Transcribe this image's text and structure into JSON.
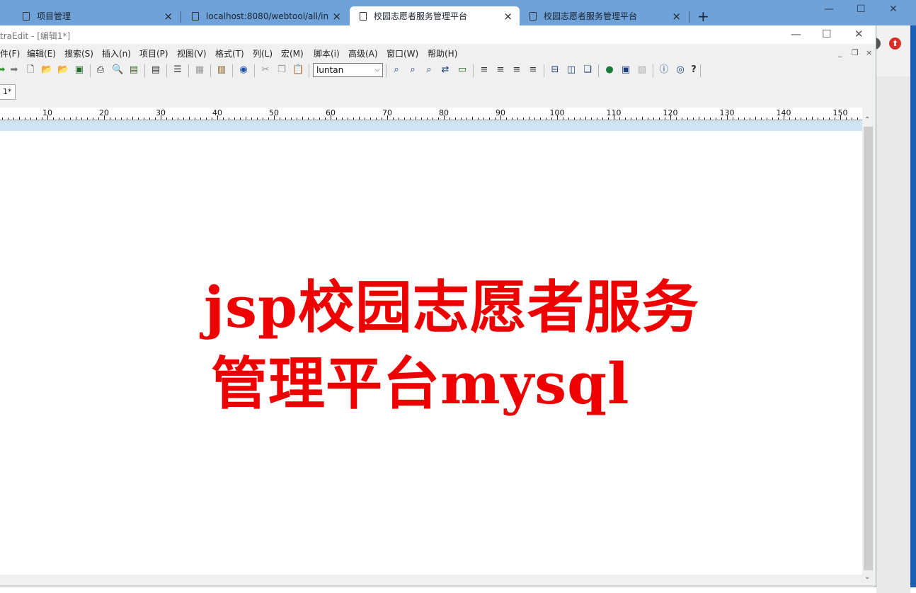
{
  "browser": {
    "tabs": [
      {
        "label": "项目管理",
        "active": false
      },
      {
        "label": "localhost:8080/webtool/all/in",
        "active": false
      },
      {
        "label": "校园志愿者服务管理平台",
        "active": true
      },
      {
        "label": "校园志愿者服务管理平台",
        "active": false
      }
    ],
    "new_tab": "+",
    "controls": {
      "minimize": "—",
      "maximize": "☐",
      "close": "✕"
    }
  },
  "editor": {
    "title": "traEdit - [编辑1*]",
    "controls": {
      "minimize": "—",
      "maximize": "☐",
      "close": "✕"
    },
    "menu": [
      "件(F)",
      "编辑(E)",
      "搜索(S)",
      "插入(n)",
      "项目(P)",
      "视图(V)",
      "格式(T)",
      "列(L)",
      "宏(M)",
      "脚本(i)",
      "高级(A)",
      "窗口(W)",
      "帮助(H)"
    ],
    "mdi_controls": {
      "minimize": "_",
      "restore": "❐",
      "close": "×"
    },
    "toolbar": {
      "font_value": "luntan",
      "dropdown_arrow": "⌵",
      "help_label": "?"
    },
    "doc_tab": "1*",
    "ruler_labels": [
      "10",
      "20",
      "30",
      "40",
      "50",
      "60",
      "70",
      "80",
      "90",
      "100",
      "110",
      "120",
      "130",
      "140",
      "150"
    ],
    "content": {
      "line1": "jsp校园志愿者服务",
      "line2": "管理平台mysql",
      "text_color": "#ee0000"
    },
    "scroll_up": "⌃",
    "scroll_down": "⌄"
  },
  "desktop": {
    "accent": "#1a5fb4",
    "red_button_glyph": "⬆"
  }
}
